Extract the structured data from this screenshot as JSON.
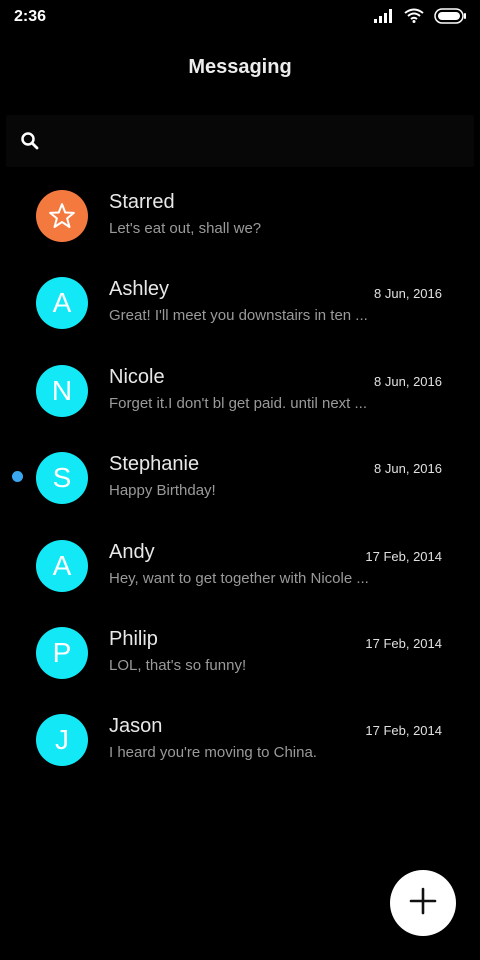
{
  "status_bar": {
    "time": "2:36",
    "icons": [
      "signal-icon",
      "wifi-icon",
      "battery-icon"
    ]
  },
  "header": {
    "title": "Messaging"
  },
  "search": {
    "icon": "search-icon"
  },
  "colors": {
    "background": "#000000",
    "starred_avatar": "#f3793f",
    "contact_avatar": "#13e8f6",
    "unread_indicator": "#3ba7f0",
    "fab": "#ffffff"
  },
  "conversations": [
    {
      "name": "Starred",
      "avatar": "star-icon",
      "date": "",
      "preview": "Let's eat out, shall we?",
      "unread": false
    },
    {
      "name": "Ashley",
      "avatar": "A",
      "date": "8 Jun, 2016",
      "preview": "Great! I'll meet you downstairs in ten ...",
      "unread": false
    },
    {
      "name": "Nicole",
      "avatar": "N",
      "date": "8 Jun, 2016",
      "preview": "Forget it.I don't bl get paid. until next ...",
      "unread": false
    },
    {
      "name": "Stephanie",
      "avatar": "S",
      "date": "8 Jun, 2016",
      "preview": "Happy Birthday!",
      "unread": true
    },
    {
      "name": "Andy",
      "avatar": "A",
      "date": "17 Feb, 2014",
      "preview": "Hey, want to get together with Nicole ...",
      "unread": false
    },
    {
      "name": "Philip",
      "avatar": "P",
      "date": "17 Feb, 2014",
      "preview": "LOL, that's so funny!",
      "unread": false
    },
    {
      "name": "Jason",
      "avatar": "J",
      "date": "17 Feb, 2014",
      "preview": "I heard you're moving to China.",
      "unread": false
    }
  ],
  "fab": {
    "icon": "plus-icon"
  }
}
